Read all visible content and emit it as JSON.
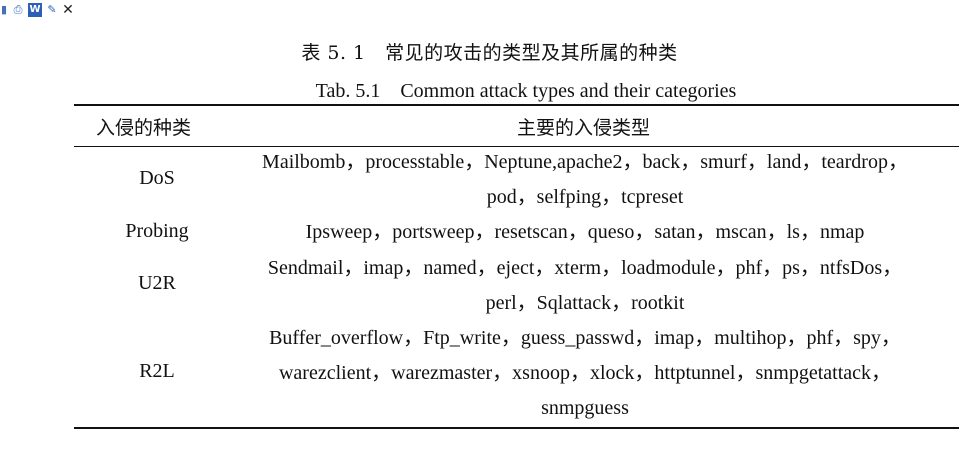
{
  "toolbar": {
    "icons": [
      "save-icon",
      "print-icon",
      "word-icon",
      "edit-icon",
      "close-icon"
    ],
    "glyphs": {
      "save": "▮",
      "print": "⎙",
      "word": "W",
      "edit": "✎",
      "close": "✕"
    }
  },
  "caption": {
    "cn": "表 5. 1　常见的攻击的类型及其所属的种类",
    "en": "Tab. 5.1　Common attack types and their categories"
  },
  "table": {
    "headers": [
      "入侵的种类",
      "主要的入侵类型"
    ],
    "rows": [
      {
        "category": "DoS",
        "lines": [
          "Mailbomb，processtable，Neptune,apache2，back，smurf，land，teardrop，",
          "pod，selfping，tcpreset"
        ]
      },
      {
        "category": "Probing",
        "lines": [
          "Ipsweep，portsweep，resetscan，queso，satan，mscan，ls，nmap"
        ]
      },
      {
        "category": "U2R",
        "lines": [
          "Sendmail，imap，named，eject，xterm，loadmodule，phf，ps，ntfsDos，",
          "perl，Sqlattack，rootkit"
        ]
      },
      {
        "category": "R2L",
        "lines": [
          "Buffer_overflow，Ftp_write，guess_passwd，imap，multihop，phf，spy，",
          "warezclient，warezmaster，xsnoop，xlock，httptunnel，snmpgetattack，",
          "snmpguess"
        ]
      }
    ]
  }
}
